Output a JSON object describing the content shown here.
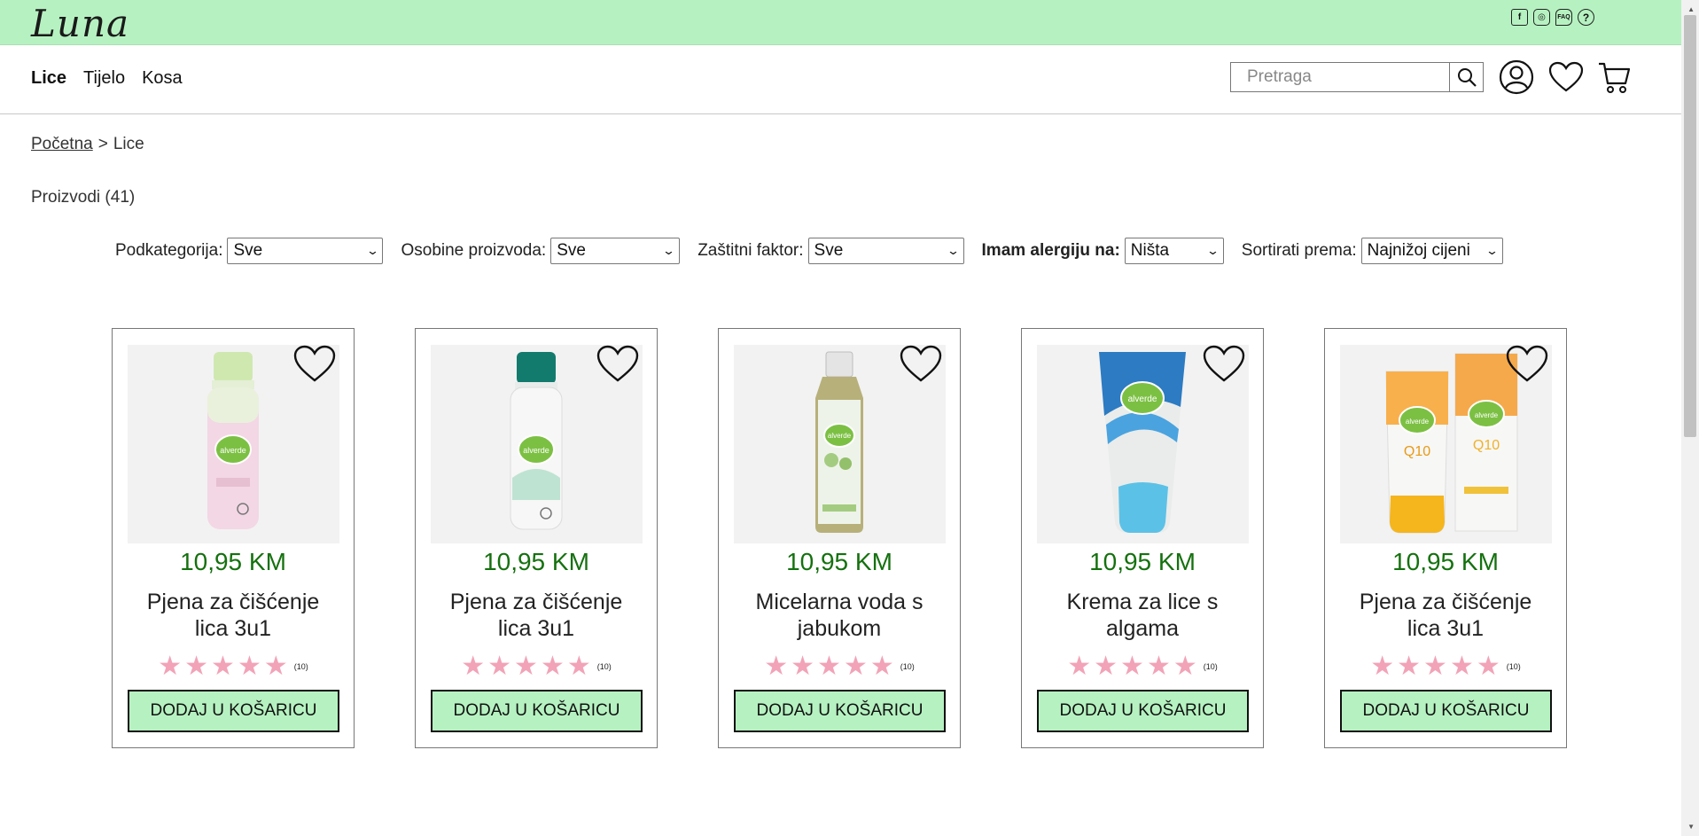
{
  "header": {
    "logo": "Luna",
    "social": [
      {
        "icon": "facebook-icon",
        "glyph": "f"
      },
      {
        "icon": "instagram-icon",
        "glyph": "◎"
      },
      {
        "icon": "faq-icon",
        "glyph": "FAQ"
      },
      {
        "icon": "help-icon",
        "glyph": "?"
      }
    ]
  },
  "nav": {
    "links": [
      {
        "label": "Lice",
        "active": true
      },
      {
        "label": "Tijelo",
        "active": false
      },
      {
        "label": "Kosa",
        "active": false
      }
    ],
    "search_placeholder": "Pretraga"
  },
  "breadcrumb": {
    "home": "Početna",
    "separator": ">",
    "current": "Lice"
  },
  "products_count": "Proizvodi (41)",
  "filters": [
    {
      "label": "Podkategorija:",
      "value": "Sve",
      "bold": false
    },
    {
      "label": "Osobine proizvoda:",
      "value": "Sve",
      "bold": false
    },
    {
      "label": "Zaštitni faktor:",
      "value": "Sve",
      "bold": false
    },
    {
      "label": "Imam alergiju na:",
      "value": "Ništa",
      "bold": true
    },
    {
      "label": "Sortirati prema:",
      "value": "Najnižoj cijeni",
      "bold": false
    }
  ],
  "products": [
    {
      "price": "10,95 KM",
      "name": "Pjena za čišćenje lica 3u1",
      "rating": 5,
      "reviews": "(10)",
      "button": "DODAJ U KOŠARICU",
      "image_type": "foam-pink"
    },
    {
      "price": "10,95 KM",
      "name": "Pjena za čišćenje lica 3u1",
      "rating": 5,
      "reviews": "(10)",
      "button": "DODAJ U KOŠARICU",
      "image_type": "foam-teal"
    },
    {
      "price": "10,95 KM",
      "name": "Micelarna voda s jabukom",
      "rating": 5,
      "reviews": "(10)",
      "button": "DODAJ U KOŠARICU",
      "image_type": "micellar"
    },
    {
      "price": "10,95 KM",
      "name": "Krema za lice s algama",
      "rating": 5,
      "reviews": "(10)",
      "button": "DODAJ U KOŠARICU",
      "image_type": "tube-blue"
    },
    {
      "price": "10,95 KM",
      "name": "Pjena za čišćenje lica 3u1",
      "rating": 5,
      "reviews": "(10)",
      "button": "DODAJ U KOŠARICU",
      "image_type": "q10-duo"
    }
  ],
  "colors": {
    "header_bg": "#b6f2c1",
    "price": "#15710f",
    "star": "#f2a3b7",
    "button_bg": "#b6f2c1"
  }
}
